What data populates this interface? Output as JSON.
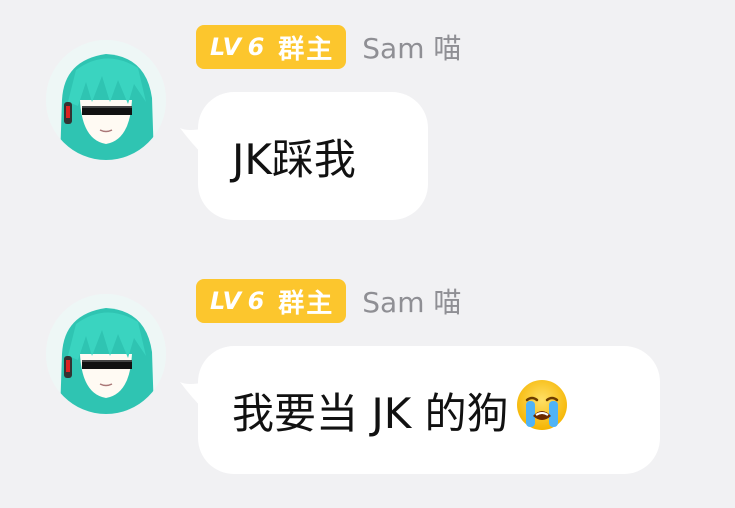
{
  "messages": [
    {
      "level_prefix": "LV",
      "level_num": "6",
      "role": "群主",
      "nickname": "Sam 喵",
      "text": "JK踩我",
      "emoji": ""
    },
    {
      "level_prefix": "LV",
      "level_num": "6",
      "role": "群主",
      "nickname": "Sam 喵",
      "text": "我要当 JK 的狗",
      "emoji": "loudly-crying-face"
    }
  ],
  "colors": {
    "badge": "#fcc62d",
    "nickname": "#8f8f94",
    "bubble": "#ffffff",
    "background": "#f1f1f3"
  }
}
